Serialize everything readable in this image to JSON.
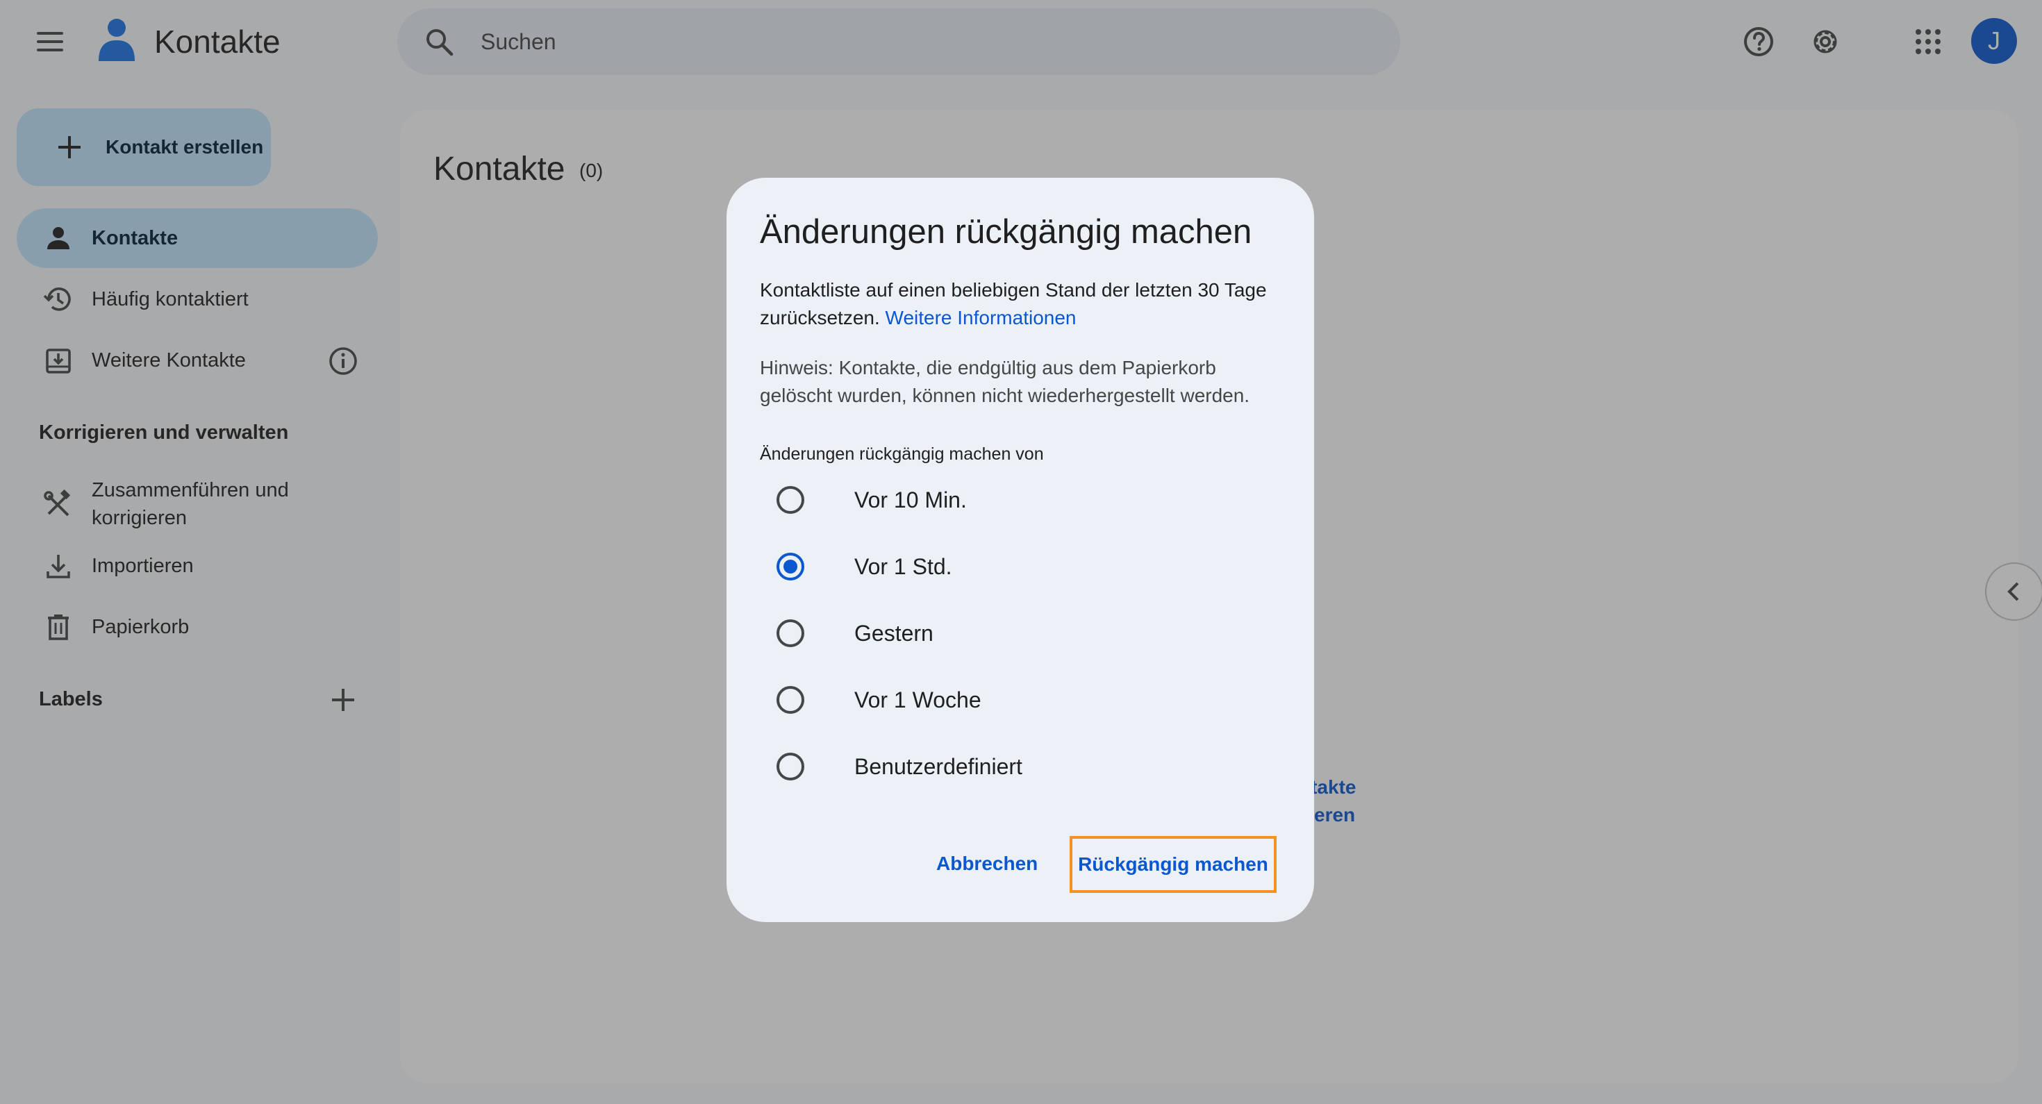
{
  "app": {
    "title": "Kontakte",
    "avatar_initial": "J",
    "accent_color": "#0b57d0",
    "active_nav_color": "#c2e7ff"
  },
  "header": {
    "menu_icon": "menu-icon",
    "search_placeholder": "Suchen",
    "icons": [
      "help-icon",
      "settings-icon",
      "apps-grid-icon"
    ]
  },
  "sidebar": {
    "create_label": "Kontakt erstellen",
    "items": [
      {
        "label": "Kontakte",
        "icon": "person-icon",
        "active": true
      },
      {
        "label": "Häufig kontaktiert",
        "icon": "history-icon"
      },
      {
        "label": "Weitere Kontakte",
        "icon": "inbox-download-icon"
      }
    ],
    "section_manage": "Korrigieren und verwalten",
    "manage_items": [
      {
        "label": "Zusammenführen und korrigieren",
        "icon": "tools-icon"
      },
      {
        "label": "Importieren",
        "icon": "download-icon"
      },
      {
        "label": "Papierkorb",
        "icon": "trash-icon"
      }
    ],
    "section_labels": "Labels"
  },
  "main": {
    "title": "Kontakte",
    "count": "(0)",
    "link_line_1": "ntakte",
    "link_line_2": "rtieren"
  },
  "dialog": {
    "title": "Änderungen rückgängig machen",
    "body_1": "Kontaktliste auf einen beliebigen Stand der letzten 30 Tage zurücksetzen.",
    "body_1_link": "Weitere Informationen",
    "body_2": "Hinweis: Kontakte, die endgültig aus dem Papierkorb gelöscht wurden, können nicht wiederhergestellt werden.",
    "options_label": "Änderungen rückgängig machen von",
    "options": [
      {
        "label": "Vor 10 Min.",
        "checked": false
      },
      {
        "label": "Vor 1 Std.",
        "checked": true
      },
      {
        "label": "Gestern",
        "checked": false
      },
      {
        "label": "Vor 1 Woche",
        "checked": false
      },
      {
        "label": "Benutzerdefiniert",
        "checked": false
      }
    ],
    "cancel_label": "Abbrechen",
    "confirm_label": "Rückgängig machen",
    "highlight_color": "#f29423"
  }
}
